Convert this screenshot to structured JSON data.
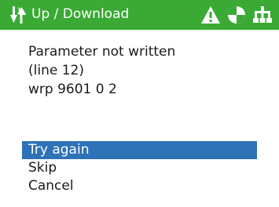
{
  "header": {
    "title": "Up / Download",
    "background_color": "#3aaa35",
    "left_icon": "transfer-arrows-icon",
    "status_icons": [
      "warning-icon",
      "sector-disc-icon",
      "network-tree-icon"
    ]
  },
  "message": {
    "lines": [
      "Parameter not written",
      "(line 12)",
      "wrp 9601 0 2"
    ]
  },
  "options": {
    "items": [
      "Try again",
      "Skip",
      "Cancel"
    ],
    "selected": "Try again",
    "selected_color": "#2f72b6"
  }
}
